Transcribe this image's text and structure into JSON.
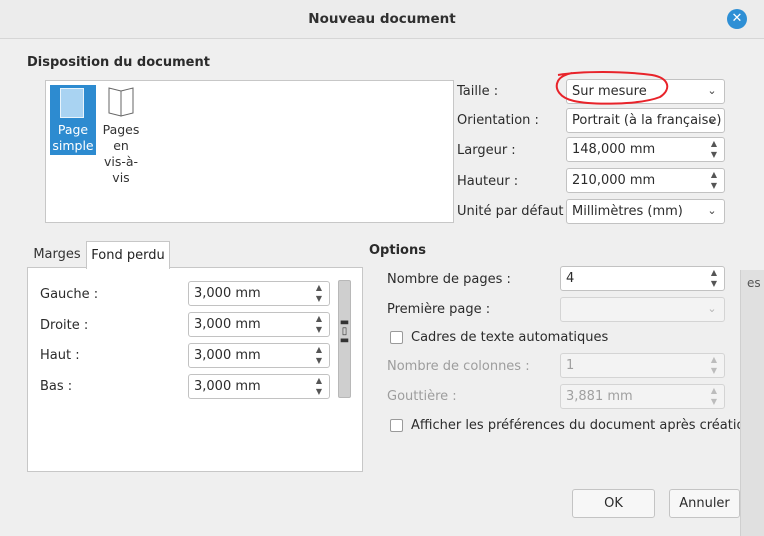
{
  "window": {
    "title": "Nouveau document",
    "close_icon": "close-icon"
  },
  "layout": {
    "section_title": "Disposition du document",
    "tiles": [
      {
        "label": "Page simple",
        "lines": [
          "Page",
          "simple"
        ],
        "selected": true,
        "icon": "single-page-icon"
      },
      {
        "label": "Pages en vis-à-vis",
        "lines": [
          "Pages",
          "en",
          "vis-à-",
          "vis"
        ],
        "selected": false,
        "icon": "facing-pages-icon"
      }
    ]
  },
  "fields": {
    "taille": {
      "label": "Taille :",
      "value": "Sur mesure"
    },
    "orientation": {
      "label": "Orientation :",
      "value": "Portrait (à la française)"
    },
    "largeur": {
      "label": "Largeur :",
      "value": "148,000 mm"
    },
    "hauteur": {
      "label": "Hauteur :",
      "value": "210,000 mm"
    },
    "unite": {
      "label": "Unité par défaut :",
      "value": "Millimètres (mm)"
    }
  },
  "tabs": [
    {
      "label": "Marges",
      "active": false
    },
    {
      "label": "Fond perdu",
      "active": true
    }
  ],
  "bleed": {
    "gauche": {
      "label": "Gauche :",
      "value": "3,000 mm"
    },
    "droite": {
      "label": "Droite :",
      "value": "3,000 mm"
    },
    "haut": {
      "label": "Haut :",
      "value": "3,000 mm"
    },
    "bas": {
      "label": "Bas :",
      "value": "3,000 mm"
    },
    "chain_icon": "chain-link-icon"
  },
  "options": {
    "title": "Options",
    "nombre_pages": {
      "label": "Nombre de pages :",
      "value": "4"
    },
    "premiere_page": {
      "label": "Première page :",
      "value": ""
    },
    "cadres_auto": {
      "label": "Cadres de texte automatiques",
      "checked": false
    },
    "nombre_colonnes": {
      "label": "Nombre de colonnes :",
      "value": "1"
    },
    "gouttiere": {
      "label": "Gouttière :",
      "value": "3,881 mm"
    },
    "afficher_prefs": {
      "label": "Afficher les préférences du document après création",
      "checked": false
    }
  },
  "buttons": {
    "ok": "OK",
    "annuler": "Annuler"
  },
  "background_edge": {
    "text": "es"
  },
  "annotation": {
    "color": "#e8232a"
  }
}
